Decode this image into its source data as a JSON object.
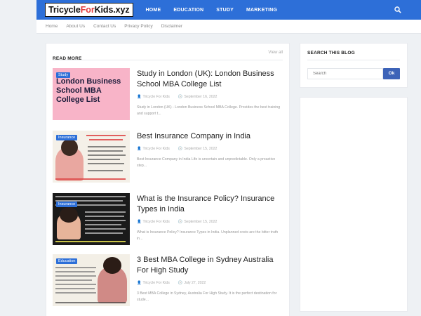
{
  "site": {
    "logo_part1": "Tricycle",
    "logo_part2": "For",
    "logo_part3": "Kids.xyz"
  },
  "nav": {
    "items": [
      {
        "label": "HOME"
      },
      {
        "label": "EDUCATION"
      },
      {
        "label": "STUDY"
      },
      {
        "label": "MARKETING"
      }
    ]
  },
  "subnav": {
    "items": [
      {
        "label": "Home"
      },
      {
        "label": "About Us"
      },
      {
        "label": "Contact Us"
      },
      {
        "label": "Privacy Policy"
      },
      {
        "label": "Disclaimer"
      }
    ]
  },
  "main": {
    "title": "READ MORE",
    "view_all": "View all"
  },
  "posts": [
    {
      "badge": "Study",
      "thumb_text": "London Business School MBA College List",
      "title": "Study in London (UK): London Business School MBA College List",
      "author": "Tricycle For Kids",
      "date": "September 16, 2022",
      "snippet": "Study in London (UK) - London Business School MBA College. Provides the best training and support t..."
    },
    {
      "badge": "Insurance",
      "title": "Best Insurance Company in India",
      "author": "Tricycle For Kids",
      "date": "September 15, 2022",
      "snippet": "Best Insurance Company in India Life is uncertain and unpredictable. Only a proactive step..."
    },
    {
      "badge": "Insurance",
      "title": "What is the Insurance Policy? Insurance Types in India",
      "author": "Tricycle For Kids",
      "date": "September 15, 2022",
      "snippet": "What is Insurance Policy? Insurance Types in India. Unplanned costs are the bitter truth in..."
    },
    {
      "badge": "Education",
      "title": "3 Best MBA College in Sydney Australia For High Study",
      "author": "Tricycle For Kids",
      "date": "July 27, 2022",
      "snippet": "3 Best MBA College in Sydney, Australia For High Study. It is the perfect destination for stude..."
    }
  ],
  "sidebar": {
    "search_title": "SEARCH THIS BLOG",
    "search_placeholder": "Search",
    "ok_label": "Ok"
  },
  "colors": {
    "topbar": "#2d6fd8",
    "badge": "#2d6fd8",
    "ok_button": "#3d63b8",
    "logo_accent": "#e23b3b",
    "thumb_pink": "#f8b4c8"
  }
}
